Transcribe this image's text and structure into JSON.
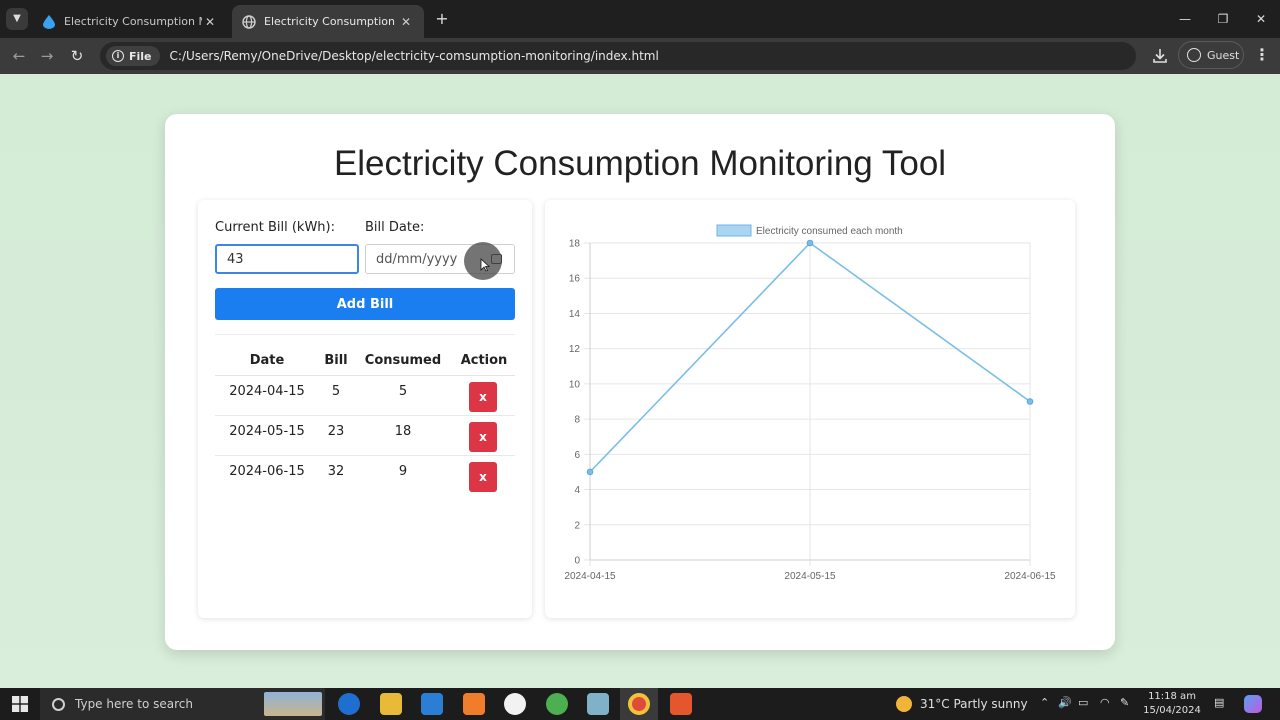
{
  "browser": {
    "tabs": [
      {
        "title": "Electricity Consumption Monitor",
        "active": false
      },
      {
        "title": "Electricity Consumption Monitor",
        "active": true
      }
    ],
    "file_chip": "File",
    "url": "C:/Users/Remy/OneDrive/Desktop/electricity-comsumption-monitoring/index.html",
    "profile_label": "Guest"
  },
  "app": {
    "title": "Electricity Consumption Monitoring Tool",
    "form": {
      "bill_label": "Current Bill (kWh):",
      "bill_value": "43",
      "date_label": "Bill Date:",
      "date_placeholder": "dd/mm/yyyy",
      "add_button": "Add Bill"
    },
    "table": {
      "headers": [
        "Date",
        "Bill",
        "Consumed",
        "Action"
      ],
      "rows": [
        {
          "date": "2024-04-15",
          "bill": "5",
          "consumed": "5",
          "action": "x"
        },
        {
          "date": "2024-05-15",
          "bill": "23",
          "consumed": "18",
          "action": "x"
        },
        {
          "date": "2024-06-15",
          "bill": "32",
          "consumed": "9",
          "action": "x"
        }
      ]
    }
  },
  "chart_data": {
    "type": "line",
    "categories": [
      "2024-04-15",
      "2024-05-15",
      "2024-06-15"
    ],
    "series": [
      {
        "name": "Electricity consumed each month",
        "values": [
          5,
          18,
          9
        ],
        "color": "#7bbfe6"
      }
    ],
    "ylim": [
      0,
      18
    ],
    "yticks": [
      0,
      2,
      4,
      6,
      8,
      10,
      12,
      14,
      16,
      18
    ],
    "grid": true,
    "legend": "top-center"
  },
  "taskbar": {
    "search_placeholder": "Type here to search",
    "weather": "31°C  Partly sunny",
    "time": "11:18 am",
    "date": "15/04/2024"
  }
}
